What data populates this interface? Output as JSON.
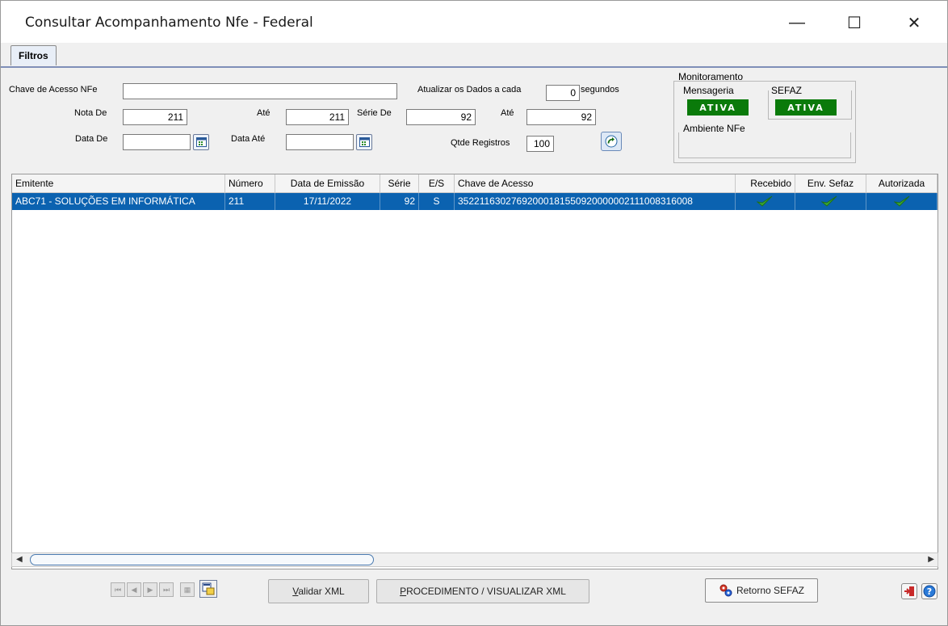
{
  "window": {
    "title": "Consultar Acompanhamento Nfe - Federal",
    "minimize": "—",
    "maximize": "☐",
    "close": "✕"
  },
  "tabs": [
    {
      "label": "Filtros"
    }
  ],
  "filters": {
    "chave_label": "Chave de Acesso NFe",
    "chave_value": "",
    "atualizar_label": "Atualizar os Dados a cada",
    "atualizar_value": "0",
    "segundos_label": "segundos",
    "nota_de_label": "Nota De",
    "nota_de_value": "211",
    "ate1_label": "Até",
    "ate1_value": "211",
    "serie_de_label": "Série De",
    "serie_de_value": "92",
    "ate2_label": "Até",
    "ate2_value": "92",
    "data_de_label": "Data De",
    "data_de_value": "",
    "data_ate_label": "Data Até",
    "data_ate_value": "",
    "qtde_label": "Qtde Registros",
    "qtde_value": "100"
  },
  "monitor": {
    "title": "Monitoramento",
    "mensageria_label": "Mensageria",
    "mensageria_status": "ATIVA",
    "sefaz_label": "SEFAZ",
    "sefaz_status": "ATIVA",
    "ambiente_label": "Ambiente NFe",
    "status_color": "#0a7a0a"
  },
  "grid": {
    "columns": [
      "Emitente",
      "Número",
      "Data de Emissão",
      "Série",
      "E/S",
      "Chave de Acesso",
      "Recebido",
      "Env. Sefaz",
      "Autorizada"
    ],
    "rows": [
      {
        "emitente": "ABC71 - SOLUÇÕES EM INFORMÁTICA",
        "numero": "211",
        "data": "17/11/2022",
        "serie": "92",
        "es": "S",
        "chave": "35221163027692000181550920000002111008316008",
        "recebido": "check-icon",
        "env_sefaz": "check-icon",
        "autorizada": "check-icon"
      }
    ],
    "selection_color": "#0b62b0"
  },
  "footer": {
    "validar_label": "Validar XML",
    "procedimento_label": "PROCEDIMENTO / VISUALIZAR XML",
    "retorno_label": "Retorno SEFAZ"
  }
}
